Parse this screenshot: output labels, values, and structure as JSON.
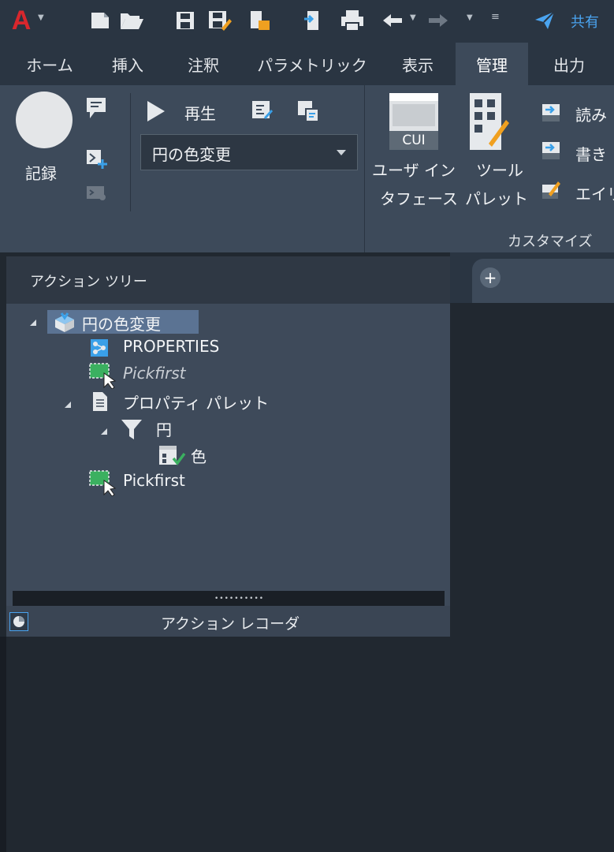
{
  "quick_access": {
    "app_menu": "A",
    "share_label": "共有"
  },
  "tabs": [
    {
      "label": "ホーム"
    },
    {
      "label": "挿入"
    },
    {
      "label": "注釈"
    },
    {
      "label": "パラメトリック"
    },
    {
      "label": "表示"
    },
    {
      "label": "管理",
      "active": true
    },
    {
      "label": "出力"
    }
  ],
  "ribbon": {
    "action_recorder": {
      "record_label": "記録",
      "play_label": "再生",
      "macro_selected": "円の色変更"
    },
    "customize": {
      "user_interface_line1": "ユーザ イン",
      "user_interface_line2": "タフェース",
      "cui_badge": "CUI",
      "tool_palette_line1": "ツール",
      "tool_palette_line2": "パレット",
      "import_label": "読み",
      "export_label": "書き",
      "alias_label": "エイリ",
      "panel_title": "カスタマイズ"
    }
  },
  "palette": {
    "title": "アクション ツリー",
    "recorder_title": "アクション レコーダ",
    "grip": "••••••••••",
    "tree": {
      "root": "円の色変更",
      "properties": "PROPERTIES",
      "pickfirst_italic": "Pickfirst",
      "property_palette": "プロパティ パレット",
      "circle": "円",
      "color": "色",
      "pickfirst": "Pickfirst"
    }
  },
  "drawing": {
    "new_tab_symbol": "+"
  },
  "colors": {
    "accent_blue": "#4aa4f0",
    "ribbon_bg": "#3d4a5a",
    "toolbar_bg": "#2a3542",
    "autocad_red": "#d8272d",
    "selection_bg": "#5b7393"
  }
}
